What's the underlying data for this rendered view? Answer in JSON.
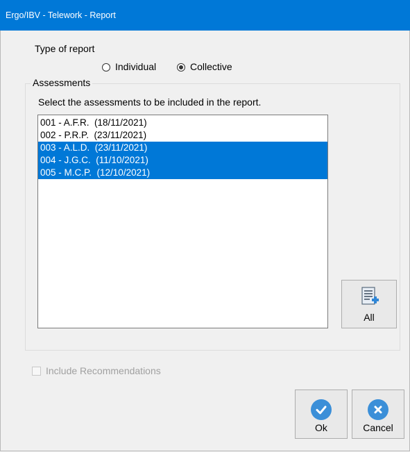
{
  "window": {
    "title": "Ergo/IBV - Telework - Report"
  },
  "report_type": {
    "label": "Type of report",
    "options": [
      {
        "label": "Individual",
        "selected": false
      },
      {
        "label": "Collective",
        "selected": true
      }
    ]
  },
  "assessments": {
    "group_label": "Assessments",
    "instruction": "Select the assessments to be included in the report.",
    "items": [
      {
        "text": "001 - A.F.R.  (18/11/2021)",
        "selected": false
      },
      {
        "text": "002 - P.R.P.  (23/11/2021)",
        "selected": false
      },
      {
        "text": "003 - A.L.D.  (23/11/2021)",
        "selected": true
      },
      {
        "text": "004 - J.G.C.  (11/10/2021)",
        "selected": true
      },
      {
        "text": "005 - M.C.P.  (12/10/2021)",
        "selected": true
      }
    ],
    "all_button": {
      "label": "All",
      "icon": "list-add-icon"
    }
  },
  "include_recommendations": {
    "label": "Include Recommendations",
    "checked": false,
    "enabled": false
  },
  "actions": {
    "ok": {
      "label": "Ok",
      "icon": "check-icon"
    },
    "cancel": {
      "label": "Cancel",
      "icon": "close-icon"
    }
  },
  "colors": {
    "accent": "#0078d7",
    "selection": "#0078d7",
    "icon_circle": "#3b8fd8"
  }
}
